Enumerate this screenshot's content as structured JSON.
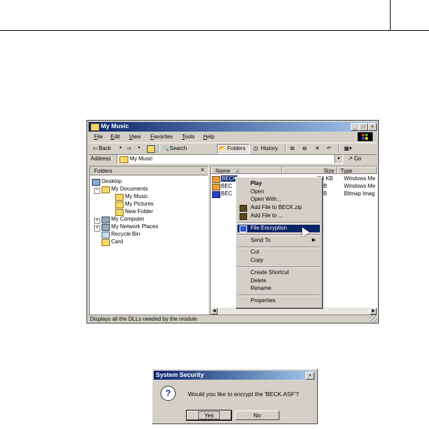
{
  "window": {
    "title": "My Music",
    "caption_buttons": [
      "_",
      "□",
      "×"
    ],
    "menu": [
      "File",
      "Edit",
      "View",
      "Favorites",
      "Tools",
      "Help"
    ],
    "toolbar": {
      "back": "⇦ Back",
      "forward": "⇨",
      "search": "Search",
      "folders": "Folders",
      "history": "History"
    },
    "address": {
      "label": "Address",
      "value": "My Music",
      "go": "Go"
    },
    "folders_pane": {
      "title": "Folders",
      "close": "×",
      "tree": [
        "Desktop",
        "My Documents",
        "My Music",
        "My Pictures",
        "New Folder",
        "My Computer",
        "My Network Places",
        "Recycle Bin",
        "Card"
      ]
    },
    "columns": {
      "name": "Name",
      "size": "Size",
      "type": "Type"
    },
    "files": [
      {
        "name": "BECK",
        "size": "474 KB",
        "type": "Windows Me"
      },
      {
        "name": "BEC",
        "size": "1 KB",
        "type": "Windows Me"
      },
      {
        "name": "BEC",
        "size": "8 KB",
        "type": "Bitmap Imag"
      }
    ],
    "status": "Displays all the DLLs needed by the module"
  },
  "context_menu": {
    "items": [
      "Play",
      "Open",
      "Open With...",
      "Add File to BECK.zip",
      "Add File to ...",
      "File Encryption",
      "Send To",
      "Cut",
      "Copy",
      "Create Shortcut",
      "Delete",
      "Rename",
      "Properties"
    ]
  },
  "dialog": {
    "title": "System Security",
    "message": "Would you like to encrypt the 'BECK.ASF'?",
    "yes": "Yes",
    "no": "No",
    "close": "×"
  }
}
